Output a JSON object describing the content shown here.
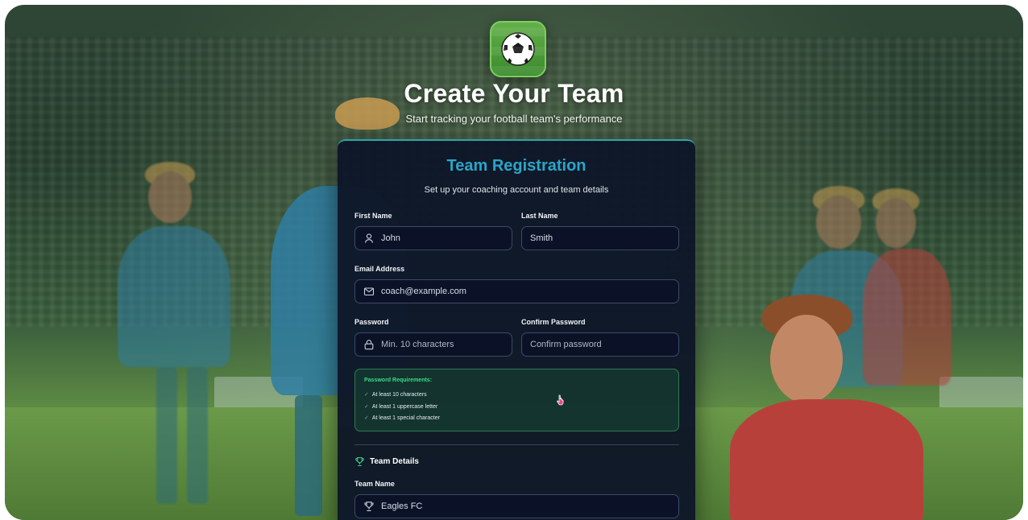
{
  "header": {
    "logo_icon": "soccer-ball-icon",
    "title": "Create Your Team",
    "subtitle": "Start tracking your football team's performance"
  },
  "card": {
    "title": "Team Registration",
    "subtitle": "Set up your coaching account and team details",
    "fields": {
      "first_name": {
        "label": "First Name",
        "value": "John",
        "icon": "user-icon"
      },
      "last_name": {
        "label": "Last Name",
        "value": "Smith"
      },
      "email": {
        "label": "Email Address",
        "value": "coach@example.com",
        "icon": "mail-icon"
      },
      "password": {
        "label": "Password",
        "placeholder": "Min. 10 characters",
        "icon": "lock-icon"
      },
      "confirm_password": {
        "label": "Confirm Password",
        "placeholder": "Confirm password"
      }
    },
    "password_requirements": {
      "title": "Password Requirements:",
      "items": [
        "At least 10 characters",
        "At least 1 uppercase letter",
        "At least 1 special character"
      ]
    },
    "team_details": {
      "section_title": "Team Details",
      "section_icon": "trophy-icon",
      "team_name_label": "Team Name",
      "team_name_value": "Eagles FC"
    }
  },
  "colors": {
    "accent": "#2aa6c8",
    "success": "#3ddc84",
    "card_bg": "#0e1628"
  }
}
